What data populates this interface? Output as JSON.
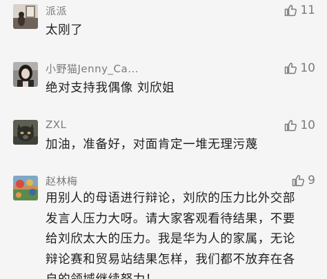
{
  "comments": [
    {
      "username": "派派",
      "text": "太刚了",
      "likes": "11",
      "avatar": "avatar-photo-window"
    },
    {
      "username": "小野猫Jenny_Ca...",
      "text": "绝对支持我偶像 刘欣姐",
      "likes": "10",
      "avatar": "avatar-photo-woman"
    },
    {
      "username": "ZXL",
      "text": "加油，准备好，对面肯定一堆无理污蔑",
      "likes": "10",
      "avatar": "avatar-photo-cat"
    },
    {
      "username": "赵林梅",
      "text_lines": [
        "用别人的母语进行辩论，刘欣的压力比外交部",
        "发言人压力大呀。请大家客观看待结果，不要",
        "给刘欣太大的压力。我是华为人的家属，无论",
        "辩论赛和贸易站结果怎样，我们都不放弃在各",
        "自的领域继续努力！"
      ],
      "likes": "9",
      "avatar": "avatar-photo-painting"
    }
  ],
  "colors": {
    "background": "#f5f5f5",
    "username": "#7a7a7a",
    "text": "#1f1f1f",
    "like": "#7a7a7a"
  },
  "icons": {
    "like": "thumbs-up-icon"
  }
}
